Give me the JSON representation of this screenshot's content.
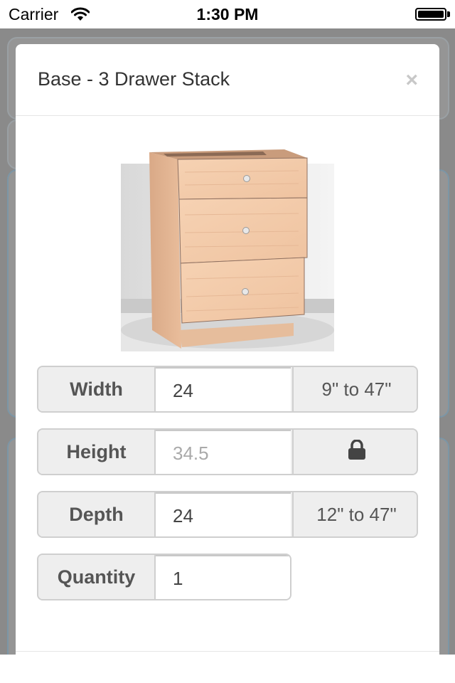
{
  "status_bar": {
    "carrier": "Carrier",
    "time": "1:30 PM"
  },
  "modal": {
    "title": "Base - 3 Drawer Stack",
    "close_symbol": "×"
  },
  "product": {
    "icon": "cabinet-3-drawer-image",
    "colors": {
      "wood": "#f2c9a6",
      "wood_dark": "#dba98a",
      "shadow": "#cfcfcf"
    }
  },
  "fields": {
    "width": {
      "label": "Width",
      "value": "24",
      "hint": "9\" to 47\""
    },
    "height": {
      "label": "Height",
      "value": "34.5",
      "locked": true,
      "icon": "lock-icon"
    },
    "depth": {
      "label": "Depth",
      "value": "24",
      "hint": "12\" to 47\""
    },
    "quantity": {
      "label": "Quantity",
      "value": "1"
    }
  }
}
